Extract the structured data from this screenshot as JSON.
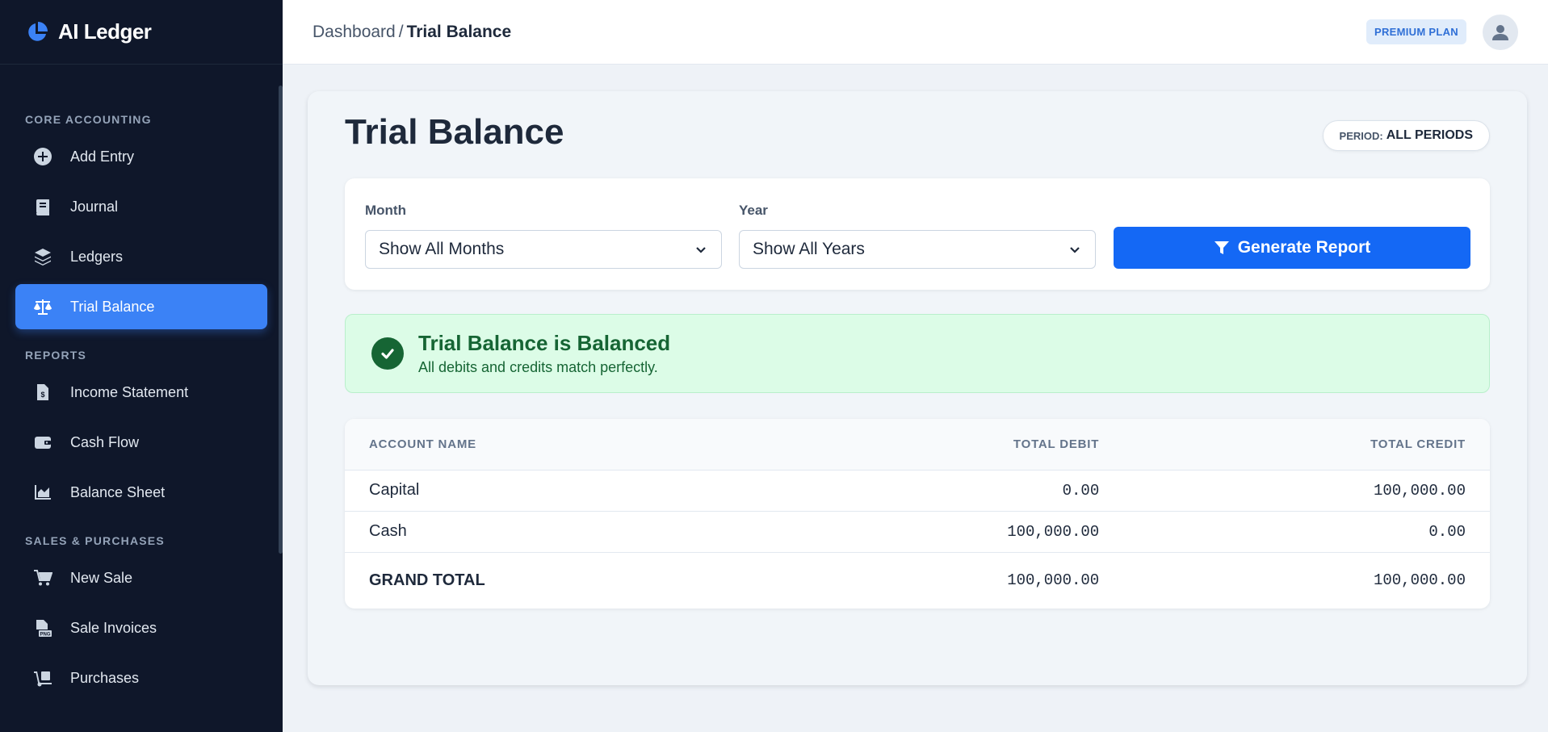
{
  "app": {
    "name": "AI Ledger"
  },
  "sidebar": {
    "sections": [
      {
        "heading": "CORE ACCOUNTING",
        "items": [
          {
            "label": "Add Entry",
            "icon": "plus-circle-icon",
            "active": false
          },
          {
            "label": "Journal",
            "icon": "book-icon",
            "active": false
          },
          {
            "label": "Ledgers",
            "icon": "layers-icon",
            "active": false
          },
          {
            "label": "Trial Balance",
            "icon": "scale-icon",
            "active": true
          }
        ]
      },
      {
        "heading": "REPORTS",
        "items": [
          {
            "label": "Income Statement",
            "icon": "invoice-dollar-icon",
            "active": false
          },
          {
            "label": "Cash Flow",
            "icon": "wallet-icon",
            "active": false
          },
          {
            "label": "Balance Sheet",
            "icon": "chart-area-icon",
            "active": false
          }
        ]
      },
      {
        "heading": "SALES & PURCHASES",
        "items": [
          {
            "label": "New Sale",
            "icon": "cart-icon",
            "active": false
          },
          {
            "label": "Sale Invoices",
            "icon": "file-png-icon",
            "active": false
          },
          {
            "label": "Purchases",
            "icon": "dolly-icon",
            "active": false
          }
        ]
      }
    ]
  },
  "topbar": {
    "breadcrumb_root": "Dashboard",
    "breadcrumb_sep": "/",
    "breadcrumb_current": "Trial Balance",
    "plan_badge": "PREMIUM PLAN"
  },
  "page": {
    "title": "Trial Balance",
    "period_label": "PERIOD:",
    "period_value": "ALL PERIODS"
  },
  "filters": {
    "month_label": "Month",
    "month_value": "Show All Months",
    "year_label": "Year",
    "year_value": "Show All Years",
    "generate_label": "Generate Report"
  },
  "alert": {
    "title": "Trial Balance is Balanced",
    "message": "All debits and credits match perfectly."
  },
  "table": {
    "headers": {
      "account": "ACCOUNT NAME",
      "debit": "TOTAL DEBIT",
      "credit": "TOTAL CREDIT"
    },
    "rows": [
      {
        "account": "Capital",
        "debit": "0.00",
        "credit": "100,000.00"
      },
      {
        "account": "Cash",
        "debit": "100,000.00",
        "credit": "0.00"
      }
    ],
    "total": {
      "account": "GRAND TOTAL",
      "debit": "100,000.00",
      "credit": "100,000.00"
    }
  },
  "colors": {
    "sidebar_bg": "#0f172a",
    "accent": "#3b82f6",
    "primary_button": "#1468f5",
    "success_bg": "#dcfce7",
    "success_text": "#166534"
  }
}
